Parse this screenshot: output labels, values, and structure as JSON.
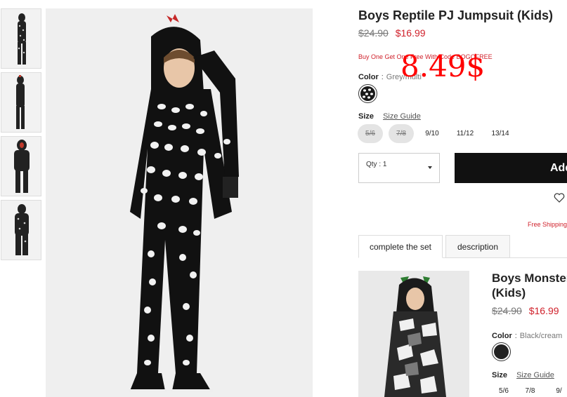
{
  "thumbnails": [
    {
      "name": "thumbnail-1"
    },
    {
      "name": "thumbnail-2"
    },
    {
      "name": "thumbnail-3"
    },
    {
      "name": "thumbnail-4"
    }
  ],
  "product": {
    "title": "Boys Reptile PJ Jumpsuit (Kids)",
    "old_price": "$24.90",
    "new_price": "$16.99",
    "promo": "Buy One Get One Free With Code BOGOFREE",
    "overlay_price": "8.49$",
    "color_label": "Color",
    "color_sep": ":",
    "color_value": "Grey/multi",
    "size_label": "Size",
    "size_guide": "Size Guide",
    "sizes": [
      {
        "label": "5/6",
        "available": false
      },
      {
        "label": "7/8",
        "available": false
      },
      {
        "label": "9/10",
        "available": true
      },
      {
        "label": "11/12",
        "available": true
      },
      {
        "label": "13/14",
        "available": true
      }
    ],
    "qty_label": "Qty : 1",
    "add_button": "Add",
    "free_shipping": "Free Shipping"
  },
  "tabs": [
    {
      "label": "complete the set",
      "active": true
    },
    {
      "label": "description",
      "active": false
    }
  ],
  "recommended": {
    "title_line1": "Boys Monster",
    "title_line2": "(Kids)",
    "old_price": "$24.90",
    "new_price": "$16.99",
    "color_label": "Color",
    "color_sep": ":",
    "color_value": "Black/cream",
    "size_label": "Size",
    "size_guide": "Size Guide",
    "sizes": [
      "5/6",
      "7/8",
      "9/"
    ]
  },
  "colors": {
    "accent_red": "#d0212b",
    "overlay_red": "#ff0000",
    "button_black": "#111111"
  }
}
